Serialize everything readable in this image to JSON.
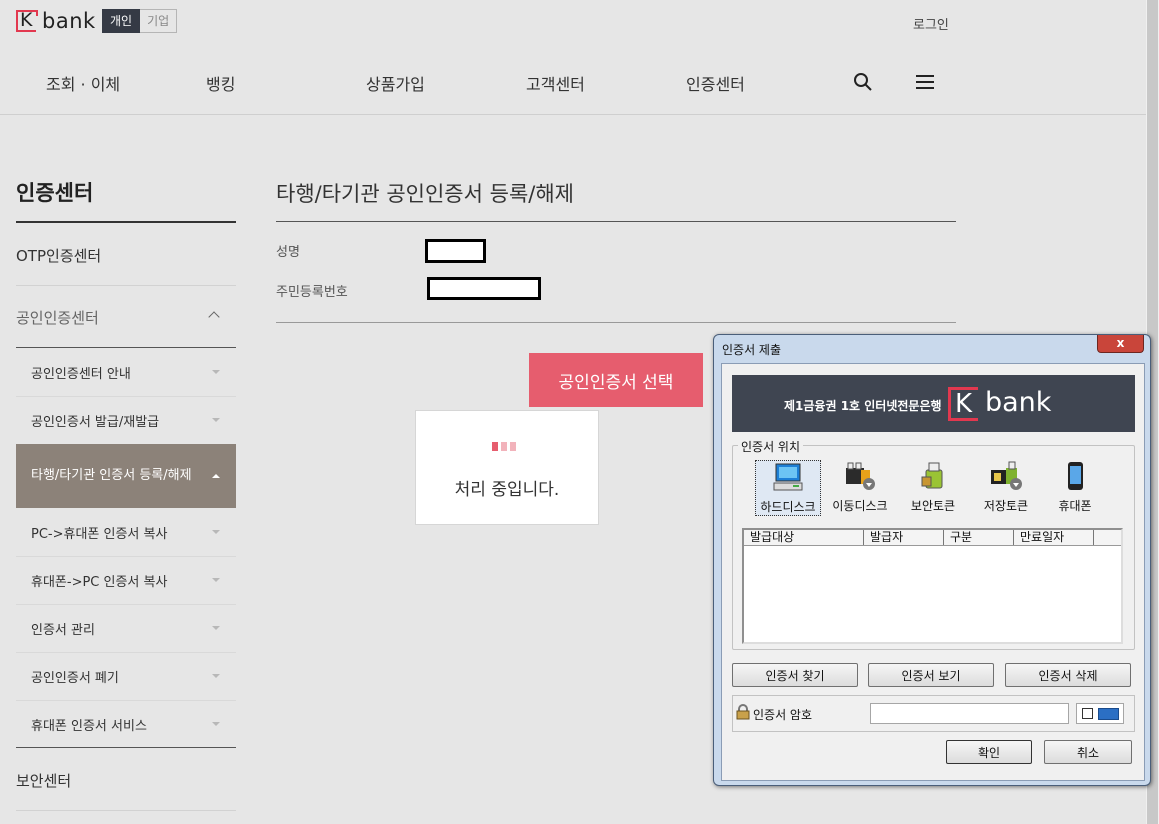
{
  "header": {
    "brand": "bank",
    "brand_k": "K",
    "seg_personal": "개인",
    "seg_corp": "기업",
    "login": "로그인",
    "nav": [
      "조회 · 이체",
      "뱅킹",
      "상품가입",
      "고객센터",
      "인증센터"
    ]
  },
  "sidebar": {
    "title": "인증센터",
    "otp": "OTP인증센터",
    "pki": "공인인증센터",
    "subitems": [
      "공인인증센터 안내",
      "공인인증서 발급/재발급",
      "타행/타기관 인증서 등록/해제",
      "PC->휴대폰 인증서 복사",
      "휴대폰->PC 인증서 복사",
      "인증서 관리",
      "공인인증서 폐기",
      "휴대폰 인증서 서비스"
    ],
    "security": "보안센터"
  },
  "main": {
    "title": "타행/타기관 공인인증서 등록/해제",
    "name_label": "성명",
    "rrn_label": "주민등록번호",
    "select_button": "공인인증서 선택",
    "processing": "처리 중입니다."
  },
  "dialog": {
    "title": "인증서 제출",
    "close": "x",
    "banner_slogan": "제1금융권 1호 인터넷전문은행",
    "banner_k": "K",
    "banner_brand": "bank",
    "location_label": "인증서 위치",
    "locations": [
      "하드디스크",
      "이동디스크",
      "보안토큰",
      "저장토큰",
      "휴대폰"
    ],
    "columns": [
      "발급대상",
      "발급자",
      "구분",
      "만료일자"
    ],
    "find": "인증서 찾기",
    "view": "인증서 보기",
    "delete": "인증서 삭제",
    "password_label": "인증서 암호",
    "ok": "확인",
    "cancel": "취소"
  },
  "colors": {
    "brand_red": "#e2384f",
    "button_pink": "#e65d6e",
    "active_menu": "#8c8279"
  }
}
